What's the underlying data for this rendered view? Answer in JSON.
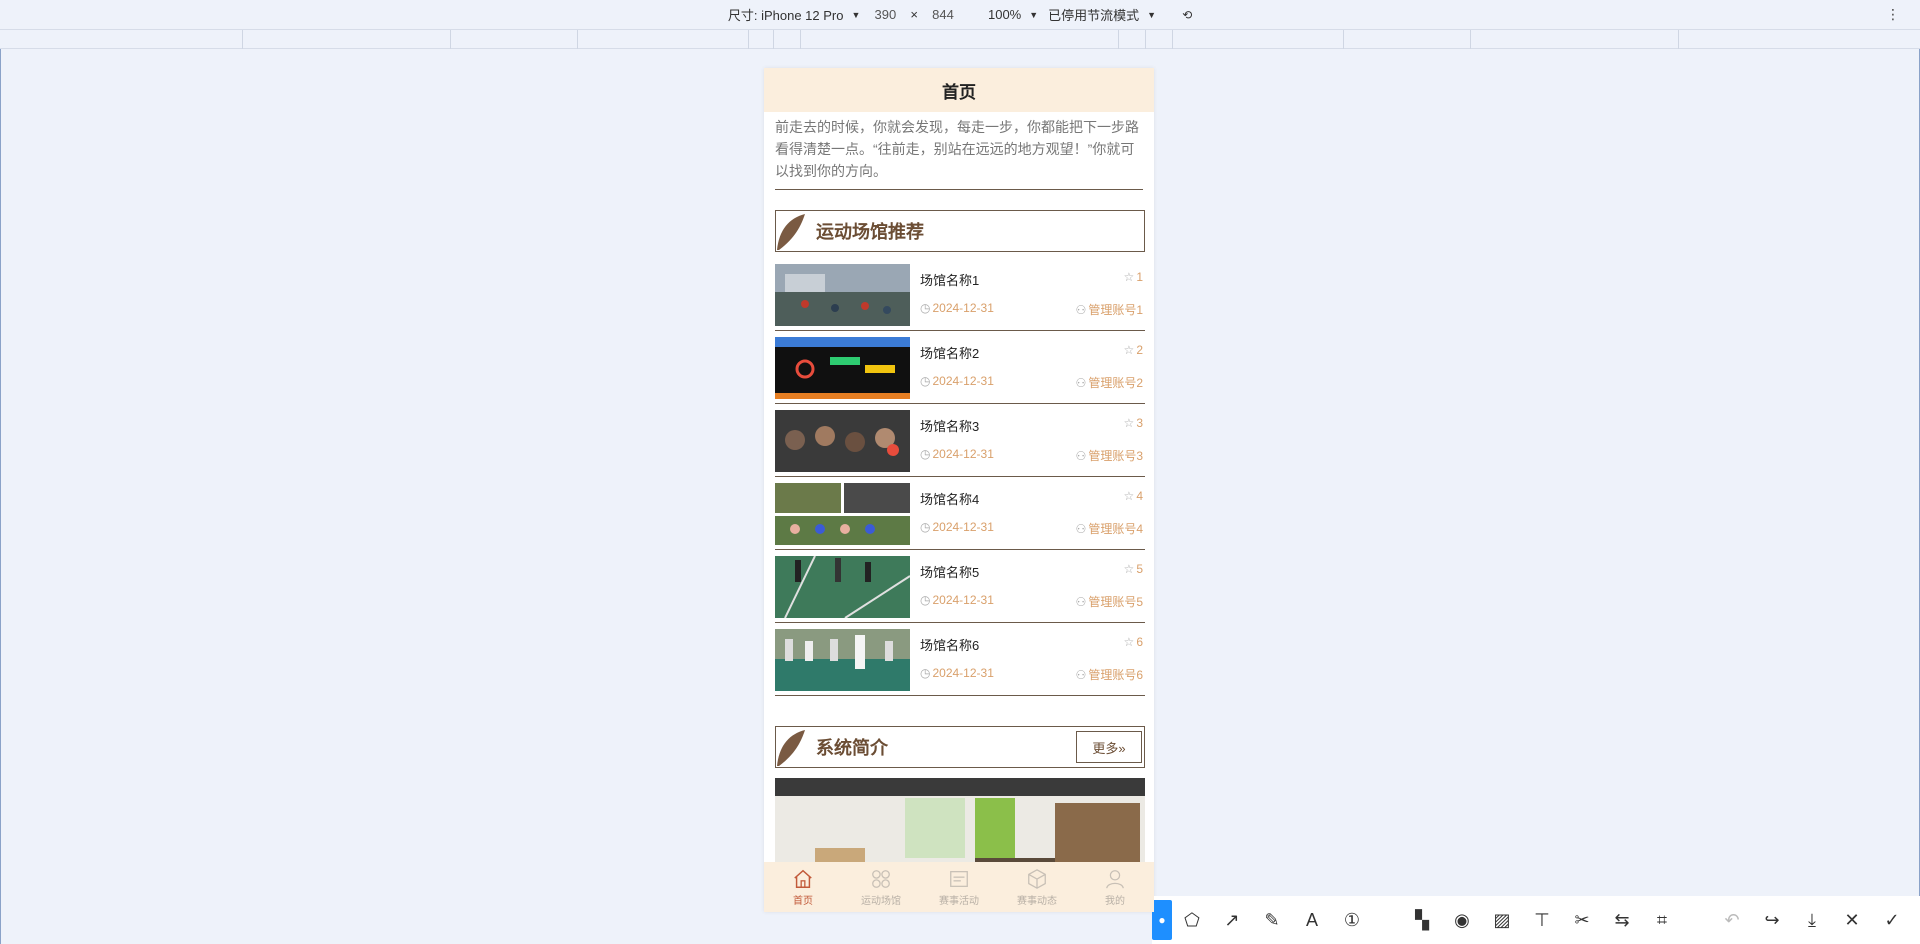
{
  "devtools": {
    "size_label": "尺寸: iPhone 12 Pro",
    "width": "390",
    "times": "×",
    "height": "844",
    "zoom": "100%",
    "throttle": "已停用节流模式"
  },
  "phone": {
    "header_title": "首页",
    "intro_text": "向着目标一小步，也许离终点很远，但你只要朝着一个方向前走去的时候，你就会发现，每走一步，你都能把下一步路看得清楚一点。“往前走，别站在远远的地方观望！”你就可以找到你的方向。",
    "venue_section_title": "运动场馆推荐",
    "venues": [
      {
        "name": "场馆名称1",
        "stars": "1",
        "date": "2024-12-31",
        "account": "管理账号1"
      },
      {
        "name": "场馆名称2",
        "stars": "2",
        "date": "2024-12-31",
        "account": "管理账号2"
      },
      {
        "name": "场馆名称3",
        "stars": "3",
        "date": "2024-12-31",
        "account": "管理账号3"
      },
      {
        "name": "场馆名称4",
        "stars": "4",
        "date": "2024-12-31",
        "account": "管理账号4"
      },
      {
        "name": "场馆名称5",
        "stars": "5",
        "date": "2024-12-31",
        "account": "管理账号5"
      },
      {
        "name": "场馆名称6",
        "stars": "6",
        "date": "2024-12-31",
        "account": "管理账号6"
      }
    ],
    "system_section_title": "系统简介",
    "more_label": "更多»",
    "tabs": [
      {
        "label": "首页",
        "icon": "home-icon",
        "active": true
      },
      {
        "label": "运动场馆",
        "icon": "grid-icon",
        "active": false
      },
      {
        "label": "赛事活动",
        "icon": "calendar-icon",
        "active": false
      },
      {
        "label": "赛事动态",
        "icon": "box-icon",
        "active": false
      },
      {
        "label": "我的",
        "icon": "user-icon",
        "active": false
      }
    ]
  },
  "colors": {
    "accent": "#d9a06b",
    "header_bg": "#fbeedd",
    "brown": "#6b4d34",
    "tab_active": "#c25a3a"
  }
}
